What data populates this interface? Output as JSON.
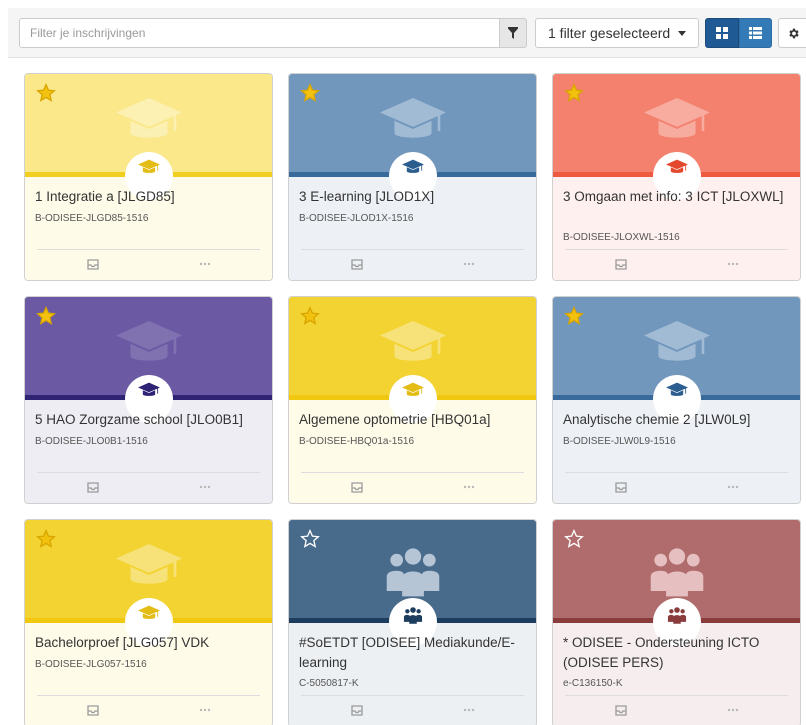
{
  "toolbar": {
    "search_placeholder": "Filter je inschrijvingen",
    "filter_dropdown_label": "1 filter geselecteerd",
    "view_grid_icon": "grid-icon",
    "view_list_icon": "list-icon",
    "settings_icon": "gear-icon"
  },
  "cards": [
    {
      "title": "1 Integratie a [JLGD85]",
      "code": "B-ODISEE-JLGD85-1516",
      "favorite": true,
      "icon": "graduation-cap-icon",
      "colors": {
        "top": "#fae88a",
        "band": "#f0cf21",
        "bottom": "#fefbe8",
        "accent": "#e3bd16",
        "bigicon": "#ffffff"
      }
    },
    {
      "title": "3 E-learning [JLOD1X]",
      "code": "B-ODISEE-JLOD1X-1516",
      "favorite": true,
      "icon": "graduation-cap-icon",
      "colors": {
        "top": "#7197bd",
        "band": "#386b9c",
        "bottom": "#edf1f5",
        "accent": "#2b5e8f",
        "bigicon": "#ffffff"
      }
    },
    {
      "title": "3 Omgaan met info: 3 ICT [JLOXWL]",
      "code": "B-ODISEE-JLOXWL-1516",
      "favorite": true,
      "icon": "graduation-cap-icon",
      "colors": {
        "top": "#f4806e",
        "band": "#ee5a3f",
        "bottom": "#fef0ee",
        "accent": "#e4482d",
        "bigicon": "#ffffff"
      }
    },
    {
      "title": "5 HAO Zorgzame school [JLO0B1]",
      "code": "B-ODISEE-JLO0B1-1516",
      "favorite": true,
      "icon": "graduation-cap-icon",
      "colors": {
        "top": "#6b5aa3",
        "band": "#2f2373",
        "bottom": "#eeedf3",
        "accent": "#2d2275",
        "bigicon": "#a99ccc"
      }
    },
    {
      "title": "Algemene optometrie [HBQ01a]",
      "code": "B-ODISEE-HBQ01a-1516",
      "favorite": true,
      "icon": "graduation-cap-icon",
      "colors": {
        "top": "#f3d332",
        "band": "#f0c80f",
        "bottom": "#fefbe8",
        "accent": "#e3bd16",
        "bigicon": "#ffffff"
      }
    },
    {
      "title": "Analytische chemie 2 [JLW0L9]",
      "code": "B-ODISEE-JLW0L9-1516",
      "favorite": true,
      "icon": "graduation-cap-icon",
      "colors": {
        "top": "#7197bd",
        "band": "#386b9c",
        "bottom": "#edf1f5",
        "accent": "#2b5e8f",
        "bigicon": "#ffffff"
      }
    },
    {
      "title": "Bachelorproef [JLG057] VDK",
      "code": "B-ODISEE-JLG057-1516",
      "favorite": true,
      "icon": "graduation-cap-icon",
      "colors": {
        "top": "#f3d332",
        "band": "#f0c80f",
        "bottom": "#fefbe8",
        "accent": "#e3bd16",
        "bigicon": "#ffffff"
      }
    },
    {
      "title": "#SoETDT [ODISEE] Mediakunde/E-learning",
      "code": "C-5050817-K",
      "favorite": false,
      "icon": "group-icon",
      "colors": {
        "top": "#486a8b",
        "band": "#1c3d5e",
        "bottom": "#edf0f3",
        "accent": "#1c3d5e",
        "bigicon": "#c9d6e3"
      }
    },
    {
      "title": "* ODISEE - Ondersteuning ICTO (ODISEE PERS)",
      "code": "e-C136150-K",
      "favorite": false,
      "icon": "group-icon",
      "colors": {
        "top": "#b06c6c",
        "band": "#8a3c3c",
        "bottom": "#f6eeee",
        "accent": "#8a3c3c",
        "bigicon": "#f0cfcf"
      }
    }
  ]
}
